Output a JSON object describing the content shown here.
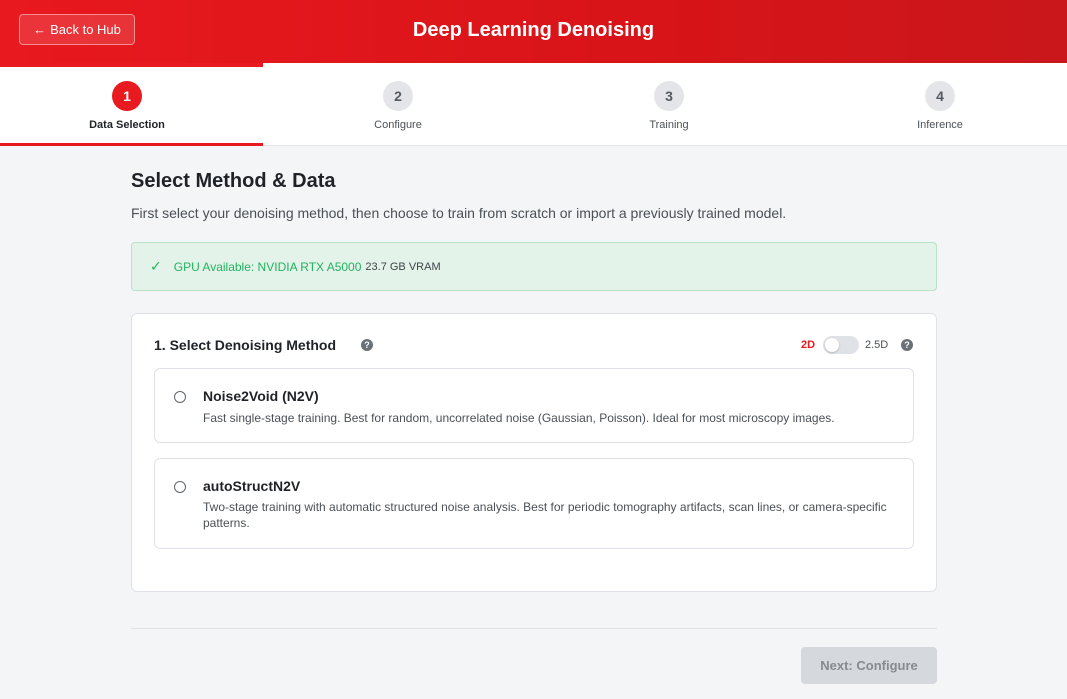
{
  "header": {
    "back_label": "Back to Hub",
    "back_arrow": "←",
    "title": "Deep Learning Denoising",
    "accent": "#e8191f"
  },
  "stepper": {
    "steps": [
      {
        "number": "1",
        "label": "Data Selection",
        "active": true
      },
      {
        "number": "2",
        "label": "Configure",
        "active": false
      },
      {
        "number": "3",
        "label": "Training",
        "active": false
      },
      {
        "number": "4",
        "label": "Inference",
        "active": false
      }
    ]
  },
  "main": {
    "title": "Select Method & Data",
    "subtitle": "First select your denoising method, then choose to train from scratch or import a previously trained model.",
    "gpu": {
      "check_icon": "✓",
      "text": "GPU Available: NVIDIA RTX A5000",
      "vram": "23.7 GB VRAM",
      "color": "#22b35e"
    },
    "method_card": {
      "title": "1. Select Denoising Method",
      "help": "?",
      "mode_2d": "2D",
      "mode_25d": "2.5D",
      "toggle_on": false,
      "options": [
        {
          "title": "Noise2Void (N2V)",
          "description": "Fast single-stage training. Best for random, uncorrelated noise (Gaussian, Poisson). Ideal for most microscopy images.",
          "selected": false
        },
        {
          "title": "autoStructN2V",
          "description": "Two-stage training with automatic structured noise analysis. Best for periodic tomography artifacts, scan lines, or camera-specific patterns.",
          "selected": false
        }
      ]
    }
  },
  "footer": {
    "next_label": "Next: Configure",
    "next_disabled": true
  }
}
